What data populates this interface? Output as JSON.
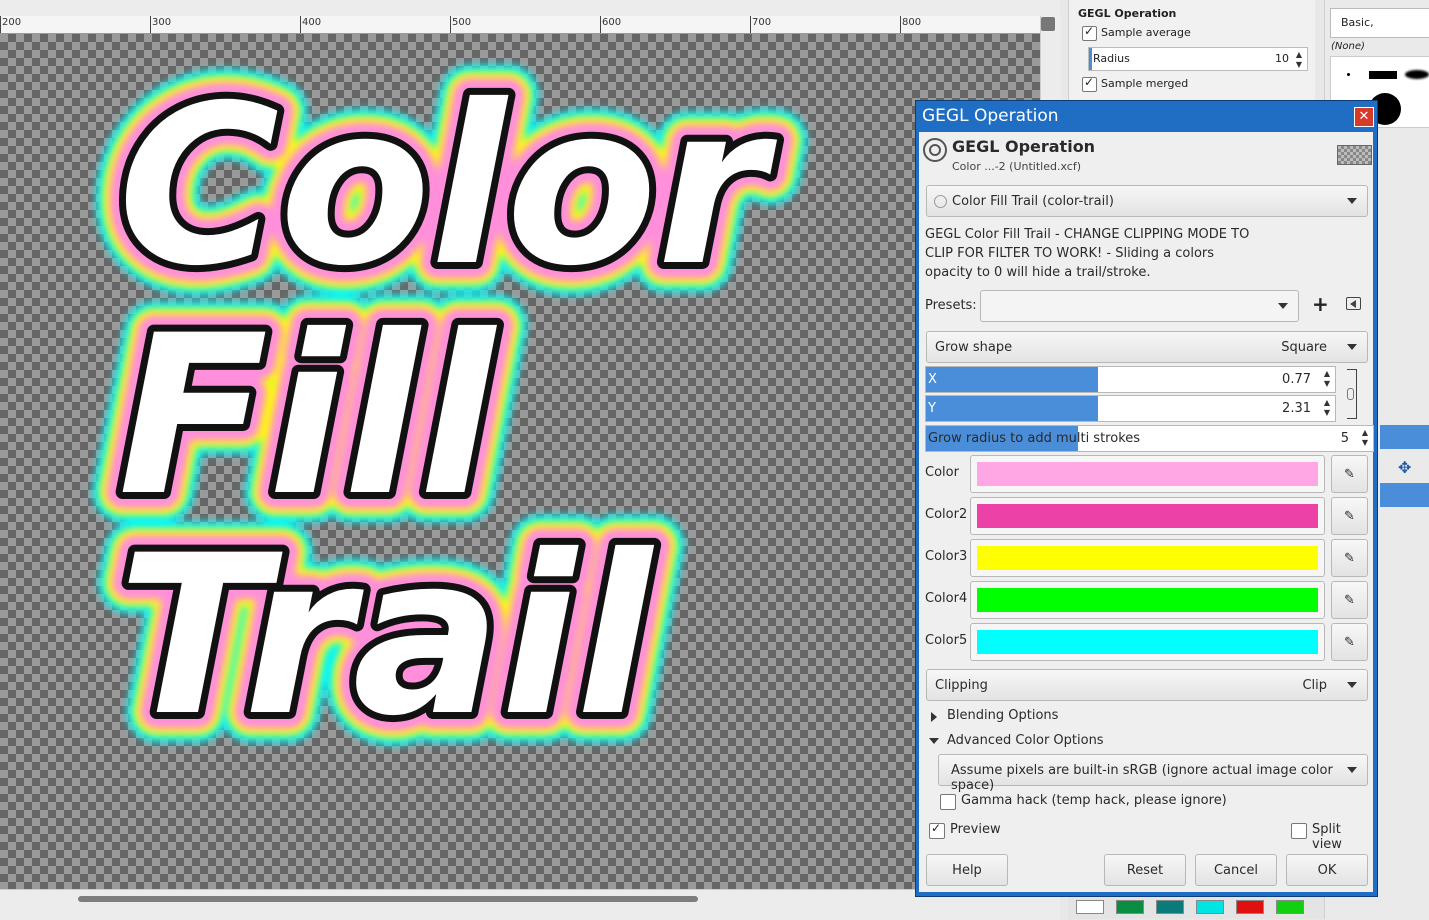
{
  "ruler": {
    "labels": [
      "200",
      "300",
      "400",
      "500",
      "600",
      "700",
      "800"
    ]
  },
  "canvas_text": {
    "line1": "Color",
    "line2": "Fill",
    "line3": "Trail"
  },
  "tool_options": {
    "title": "GEGL Operation",
    "sample_average_label": "Sample average",
    "radius_label": "Radius",
    "radius_value": "10",
    "sample_merged_label": "Sample merged"
  },
  "brushes": {
    "preset": "Basic,",
    "none_label": "(None)"
  },
  "dialog": {
    "window_title": "GEGL Operation",
    "header_title": "GEGL Operation",
    "header_subtitle": "Color ...-2 (Untitled.xcf)",
    "operation": "Color Fill Trail (color-trail)",
    "description": "GEGL Color Fill Trail - CHANGE CLIPPING MODE TO CLIP FOR FILTER TO WORK! - Sliding a colors opacity to 0 will hide a trail/stroke.",
    "presets_label": "Presets:",
    "grow_shape_label": "Grow shape",
    "grow_shape_value": "Square",
    "x_label": "X",
    "x_value": "0.77",
    "x_fill_fraction": 0.42,
    "y_label": "Y",
    "y_value": "2.31",
    "y_fill_fraction": 0.42,
    "grow_radius_label": "Grow radius to add multi strokes",
    "grow_radius_value": "5",
    "grow_radius_fill_fraction": 0.34,
    "colors": [
      {
        "label": "Color",
        "hex": "#ffa6e4"
      },
      {
        "label": "Color2",
        "hex": "#ec41a6"
      },
      {
        "label": "Color3",
        "hex": "#ffff00"
      },
      {
        "label": "Color4",
        "hex": "#00ff00"
      },
      {
        "label": "Color5",
        "hex": "#00ffff"
      }
    ],
    "clipping_label": "Clipping",
    "clipping_value": "Clip",
    "blending_options": "Blending Options",
    "advanced_color_options": "Advanced Color Options",
    "color_space_option": "Assume pixels are built-in sRGB (ignore actual image color space)",
    "gamma_hack_label": "Gamma hack (temp hack, please ignore)",
    "preview_label": "Preview",
    "preview_checked": true,
    "split_view_label": "Split view",
    "buttons": {
      "help": "Help",
      "reset": "Reset",
      "cancel": "Cancel",
      "ok": "OK"
    }
  }
}
